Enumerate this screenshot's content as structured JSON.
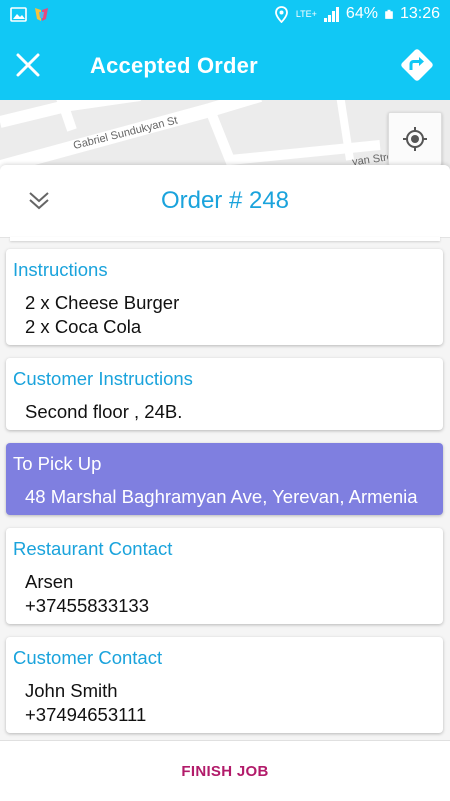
{
  "status_bar": {
    "battery": "64%",
    "time": "13:26",
    "network": "LTE+",
    "bg_color": "#11c8f5"
  },
  "toolbar": {
    "title": "Accepted Order",
    "close_icon": "close-icon",
    "navigate_icon": "directions-icon"
  },
  "map": {
    "street_1": "Gabriel Sundukyan St",
    "street_2": "yan Street",
    "locate_icon": "my-location-icon"
  },
  "sheet": {
    "title": "Order # 248",
    "collapse_icon": "chevron-double-down-icon"
  },
  "cards": {
    "instructions": {
      "label": "Instructions",
      "lines": [
        "2 x Cheese Burger",
        "2 x Coca Cola"
      ]
    },
    "customer_instructions": {
      "label": "Customer Instructions",
      "lines": [
        "Second floor , 24B."
      ]
    },
    "pickup": {
      "label": "To Pick Up",
      "lines": [
        "48 Marshal Baghramyan Ave, Yerevan, Armenia"
      ],
      "bg_color": "#7f7fe0"
    },
    "restaurant_contact": {
      "label": "Restaurant Contact",
      "lines": [
        "Arsen",
        "+37455833133"
      ]
    },
    "customer_contact": {
      "label": "Customer Contact",
      "lines": [
        "John Smith",
        "+37494653111"
      ]
    }
  },
  "footer": {
    "finish_label": "FINISH JOB",
    "finish_color": "#b21b6a"
  },
  "accent_color": "#1aa3dc"
}
